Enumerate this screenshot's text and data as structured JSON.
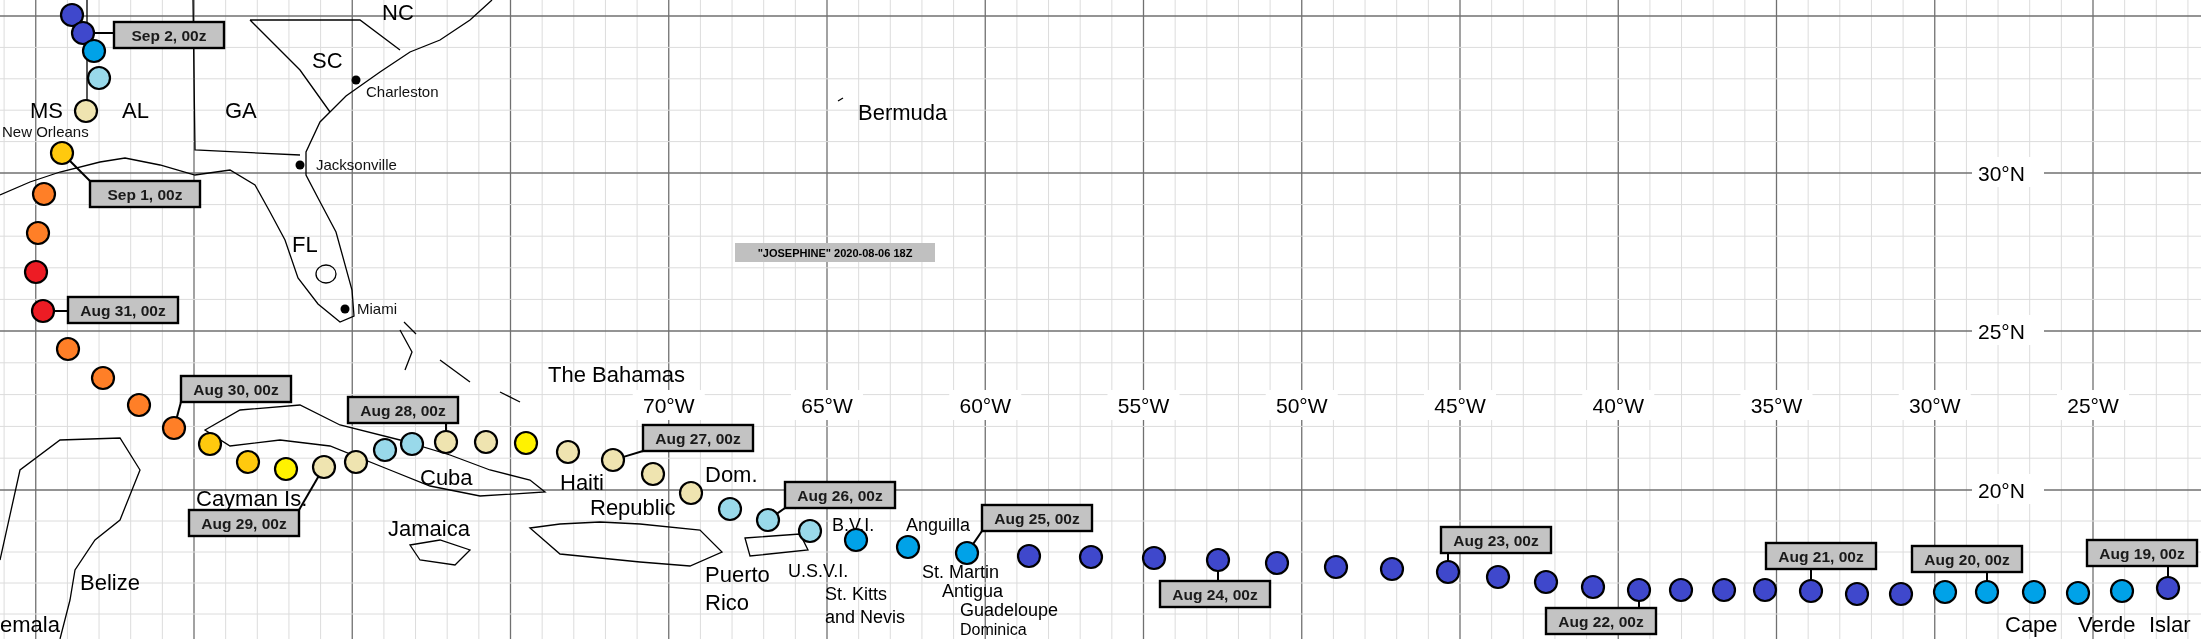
{
  "title": "\"JOSEPHINE\" 2020-08-06 18Z",
  "lat_labels": [
    "30°N",
    "25°N",
    "20°N"
  ],
  "lon_labels": [
    "70°W",
    "65°W",
    "60°W",
    "55°W",
    "50°W",
    "45°W",
    "40°W",
    "35°W",
    "30°W",
    "25°W"
  ],
  "places": [
    {
      "lines": [
        "NC"
      ],
      "kind": "region"
    },
    {
      "lines": [
        "SC"
      ],
      "kind": "region"
    },
    {
      "lines": [
        "Charleston"
      ],
      "kind": "city"
    },
    {
      "lines": [
        "MS"
      ],
      "kind": "region"
    },
    {
      "lines": [
        "AL"
      ],
      "kind": "region"
    },
    {
      "lines": [
        "GA"
      ],
      "kind": "region"
    },
    {
      "lines": [
        "New Orleans"
      ],
      "kind": "town"
    },
    {
      "lines": [
        "Jacksonville"
      ],
      "kind": "city"
    },
    {
      "lines": [
        "FL"
      ],
      "kind": "region"
    },
    {
      "lines": [
        "Miami"
      ],
      "kind": "city"
    },
    {
      "lines": [
        "Bermuda"
      ],
      "kind": "region"
    },
    {
      "lines": [
        "The Bahamas"
      ],
      "kind": "region"
    },
    {
      "lines": [
        "Cuba"
      ],
      "kind": "region"
    },
    {
      "lines": [
        "Cayman Is."
      ],
      "kind": "region"
    },
    {
      "lines": [
        "Jamaica"
      ],
      "kind": "region"
    },
    {
      "lines": [
        "Haiti"
      ],
      "kind": "region"
    },
    {
      "lines": [
        "Dom."
      ],
      "kind": "region"
    },
    {
      "lines": [
        "Republic"
      ],
      "kind": "region"
    },
    {
      "lines": [
        "Puerto",
        "Rico"
      ],
      "kind": "region"
    },
    {
      "lines": [
        "U.S.V.I."
      ],
      "kind": "island"
    },
    {
      "lines": [
        "B.V.I."
      ],
      "kind": "island"
    },
    {
      "lines": [
        "Anguilla"
      ],
      "kind": "island"
    },
    {
      "lines": [
        "St. Martin"
      ],
      "kind": "island"
    },
    {
      "lines": [
        "St. Kitts",
        "and Nevis"
      ],
      "kind": "island"
    },
    {
      "lines": [
        "Antigua"
      ],
      "kind": "island"
    },
    {
      "lines": [
        "Guadeloupe"
      ],
      "kind": "island"
    },
    {
      "lines": [
        "Dominica"
      ],
      "kind": "island"
    },
    {
      "lines": [
        "Belize"
      ],
      "kind": "region"
    },
    {
      "lines": [
        "emala"
      ],
      "kind": "region"
    },
    {
      "lines": [
        "Cape"
      ],
      "kind": "region"
    },
    {
      "lines": [
        "Verde"
      ],
      "kind": "region"
    },
    {
      "lines": [
        "Islar"
      ],
      "kind": "region"
    }
  ],
  "track": [
    {
      "color": "#3f48cc"
    },
    {
      "color": "#3f48cc",
      "label": "Sep 2, 00z"
    },
    {
      "color": "#00a2e8"
    },
    {
      "color": "#99d9ea"
    },
    {
      "color": "#efe4b0"
    },
    {
      "color": "#ffc90e",
      "label": "Sep 1, 00z"
    },
    {
      "color": "#ff7f27"
    },
    {
      "color": "#ff7f27"
    },
    {
      "color": "#ed1c24"
    },
    {
      "color": "#ed1c24",
      "label": "Aug 31, 00z"
    },
    {
      "color": "#ff7f27"
    },
    {
      "color": "#ff7f27"
    },
    {
      "color": "#ff7f27"
    },
    {
      "color": "#ff7f27",
      "label": "Aug 30, 00z"
    },
    {
      "color": "#ffc90e"
    },
    {
      "color": "#ffc90e"
    },
    {
      "color": "#fff200"
    },
    {
      "color": "#efe4b0",
      "label": "Aug 29, 00z"
    },
    {
      "color": "#efe4b0"
    },
    {
      "color": "#99d9ea"
    },
    {
      "color": "#99d9ea"
    },
    {
      "color": "#efe4b0",
      "label": "Aug 28, 00z"
    },
    {
      "color": "#efe4b0"
    },
    {
      "color": "#fff200"
    },
    {
      "color": "#efe4b0"
    },
    {
      "color": "#efe4b0",
      "label": "Aug 27, 00z"
    },
    {
      "color": "#efe4b0"
    },
    {
      "color": "#efe4b0"
    },
    {
      "color": "#99d9ea"
    },
    {
      "color": "#99d9ea",
      "label": "Aug 26, 00z"
    },
    {
      "color": "#99d9ea"
    },
    {
      "color": "#00a2e8"
    },
    {
      "color": "#00a2e8"
    },
    {
      "color": "#00a2e8",
      "label": "Aug 25, 00z"
    },
    {
      "color": "#3f48cc"
    },
    {
      "color": "#3f48cc"
    },
    {
      "color": "#3f48cc"
    },
    {
      "color": "#3f48cc",
      "label": "Aug 24, 00z"
    },
    {
      "color": "#3f48cc"
    },
    {
      "color": "#3f48cc"
    },
    {
      "color": "#3f48cc"
    },
    {
      "color": "#3f48cc",
      "label": "Aug 23, 00z"
    },
    {
      "color": "#3f48cc"
    },
    {
      "color": "#3f48cc"
    },
    {
      "color": "#3f48cc"
    },
    {
      "color": "#3f48cc",
      "label": "Aug 22, 00z"
    },
    {
      "color": "#3f48cc"
    },
    {
      "color": "#3f48cc"
    },
    {
      "color": "#3f48cc"
    },
    {
      "color": "#3f48cc",
      "label": "Aug 21, 00z"
    },
    {
      "color": "#3f48cc"
    },
    {
      "color": "#3f48cc"
    },
    {
      "color": "#00a2e8"
    },
    {
      "color": "#00a2e8",
      "label": "Aug 20, 00z"
    },
    {
      "color": "#00a2e8"
    },
    {
      "color": "#00a2e8"
    },
    {
      "color": "#00a2e8"
    },
    {
      "color": "#3f48cc",
      "label": "Aug 19, 00z"
    }
  ]
}
